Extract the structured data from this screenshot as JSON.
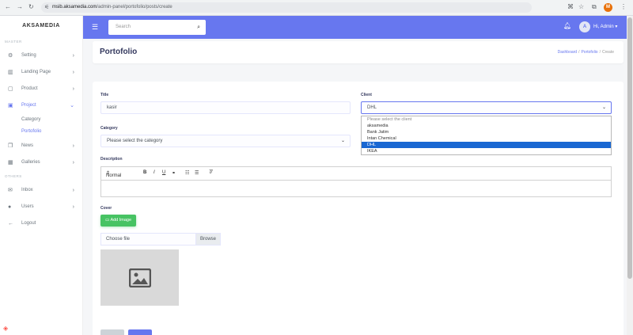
{
  "browser": {
    "url_host": "msib.aksamedia.com",
    "url_path": "/admin-panel/portofolio/posts/create",
    "profile_initial": "M"
  },
  "sidebar": {
    "brand": "AKSAMEDIA",
    "section_master": "MASTER",
    "section_others": "OTHERS",
    "items": [
      {
        "label": "Setting",
        "icon": "gear-icon"
      },
      {
        "label": "Landing Page",
        "icon": "map-icon"
      },
      {
        "label": "Product",
        "icon": "file-icon"
      },
      {
        "label": "Project",
        "icon": "image-icon"
      },
      {
        "label": "News",
        "icon": "copy-icon"
      },
      {
        "label": "Galleries",
        "icon": "gallery-icon"
      },
      {
        "label": "Inbox",
        "icon": "envelope-icon"
      },
      {
        "label": "Users",
        "icon": "user-icon"
      },
      {
        "label": "Logout",
        "icon": "arrow-left-icon"
      }
    ],
    "sub_items": [
      {
        "label": "Category"
      },
      {
        "label": "Portofolio"
      }
    ]
  },
  "topbar": {
    "search_placeholder": "Search",
    "user_greeting": "Hi, Admin"
  },
  "page": {
    "title": "Portofolio",
    "breadcrumb": [
      "Dashboard",
      "Portofolio",
      "Create"
    ]
  },
  "form": {
    "title_label": "Title",
    "title_value": "kasir",
    "client_label": "Client",
    "client_value": "DHL",
    "client_options": [
      "Please select the client",
      "aksamedia",
      "Bank Jatim",
      "Intan Chemical",
      "DHL",
      "IKEA"
    ],
    "category_label": "Category",
    "category_value": "Please select the category",
    "description_label": "Description",
    "toolbar_style": "Normal",
    "cover_label": "Cover",
    "add_image_label": "Add Image",
    "choose_file": "Choose file",
    "browse": "Browse"
  },
  "colors": {
    "primary": "#6777ef",
    "success": "#47c363",
    "selected_option": "#1967d2"
  }
}
